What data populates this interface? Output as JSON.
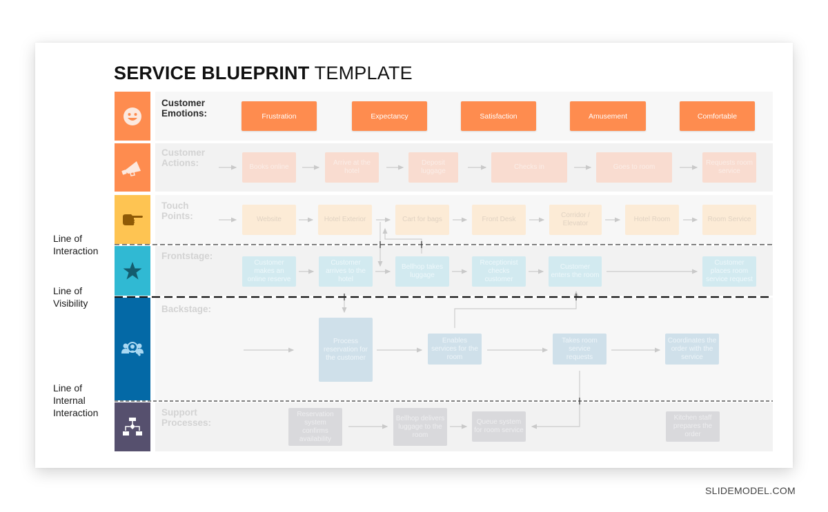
{
  "title": {
    "bold": "SERVICE BLUEPRINT",
    "light": "TEMPLATE"
  },
  "colors": {
    "emotions": "#fe8c4f",
    "actions": "#fe8c4f",
    "touch_points": "#fec452",
    "frontstage": "#30b9d3",
    "backstage": "#0469a6",
    "support": "#56506e"
  },
  "lanes": {
    "emotions": {
      "label": "Customer\nEmotions:",
      "icon": "smiley-face-icon",
      "items": [
        "Frustration",
        "Expectancy",
        "Satisfaction",
        "Amusement",
        "Comfortable"
      ]
    },
    "actions": {
      "label": "Customer\nActions:",
      "icon": "megaphone-icon",
      "items": [
        "Books online",
        "Arrive at the hotel",
        "Deposit luggage",
        "Checks in",
        "Goes to room",
        "Requests room service"
      ]
    },
    "touch_points": {
      "label": "Touch\nPoints:",
      "icon": "pointing-hand-icon",
      "items": [
        "Website",
        "Hotel Exterior",
        "Cart for bags",
        "Front Desk",
        "Corridor / Elevator",
        "Hotel Room",
        "Room Service"
      ]
    },
    "frontstage": {
      "label": "Frontstage:",
      "icon": "star-icon",
      "items": [
        "Customer makes an online reserve",
        "Customer arrives to the hotel",
        "Bellhop takes luggage",
        "Receptionist checks customer",
        "Customer enters the room",
        "Customer places room service request"
      ]
    },
    "backstage": {
      "label": "Backstage:",
      "icon": "people-search-icon",
      "items": [
        "Process reservation for the customer",
        "Enables services for the room",
        "Takes room service requests",
        "Coordinates the order with the service"
      ]
    },
    "support": {
      "label": "Support\nProcesses:",
      "icon": "flowchart-icon",
      "items": [
        "Reservation system confirms availability",
        "Bellhop delivers luggage to the room",
        "Queue system for room service",
        "Kitchen staff prepares the order"
      ]
    }
  },
  "lines": {
    "interaction": "Line of\nInteraction",
    "visibility": "Line of\nVisibility",
    "internal": "Line of\nInternal\nInteraction"
  },
  "watermark": "SLIDEMODEL.COM"
}
